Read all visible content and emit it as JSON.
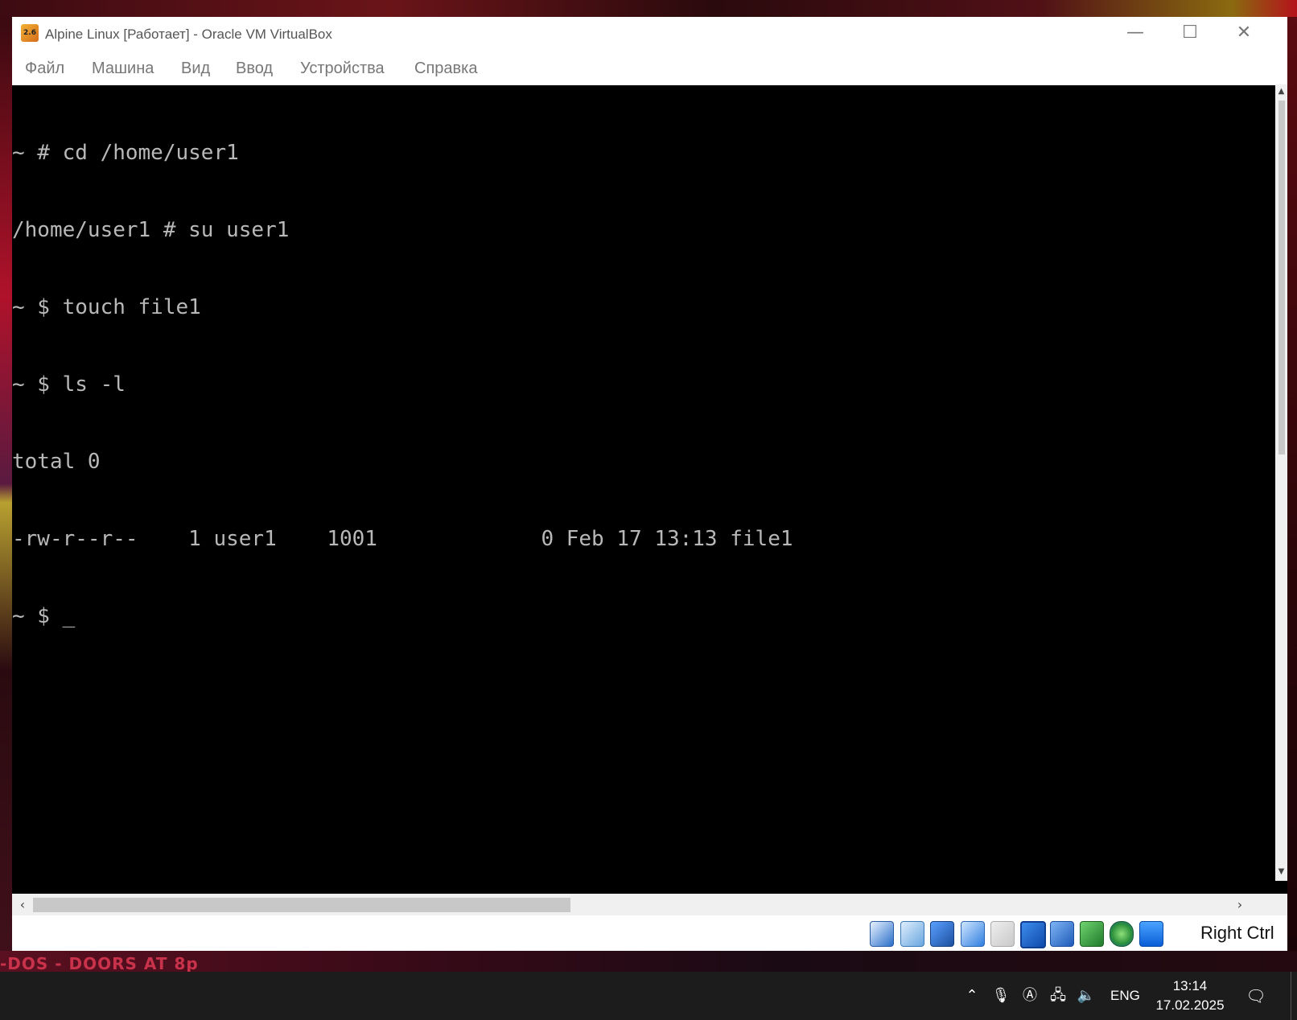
{
  "window": {
    "title": "Alpine Linux [Работает] - Oracle VM VirtualBox",
    "app_icon_text": "2.6",
    "minimize": "—",
    "maximize": "☐",
    "close": "✕"
  },
  "menu": {
    "items": [
      "Файл",
      "Машина",
      "Вид",
      "Ввод",
      "Устройства",
      "Справка"
    ]
  },
  "console": {
    "lines": [
      "~ # cd /home/user1",
      "/home/user1 # su user1",
      "~ $ touch file1",
      "~ $ ls -l",
      "total 0",
      "-rw-r--r--    1 user1    1001             0 Feb 17 13:13 file1",
      "~ $ _"
    ]
  },
  "statusbar": {
    "icons": [
      "hard-disk-icon",
      "optical-drive-icon",
      "audio-icon",
      "network-icon",
      "usb-icon",
      "shared-folders-icon",
      "display-icon",
      "video-capture-icon",
      "recording-icon",
      "guest-additions-icon",
      "mouse-integration-icon"
    ],
    "host_key": "Right Ctrl"
  },
  "taskbar": {
    "language": "ENG",
    "time": "13:14",
    "date": "17.02.2025"
  },
  "wallpaper": {
    "text": "-DOS - DOORS AT 8p"
  },
  "colors": {
    "console_bg": "#000000",
    "console_fg": "#b8b8b8",
    "taskbar_bg": "#1c1c1c"
  }
}
